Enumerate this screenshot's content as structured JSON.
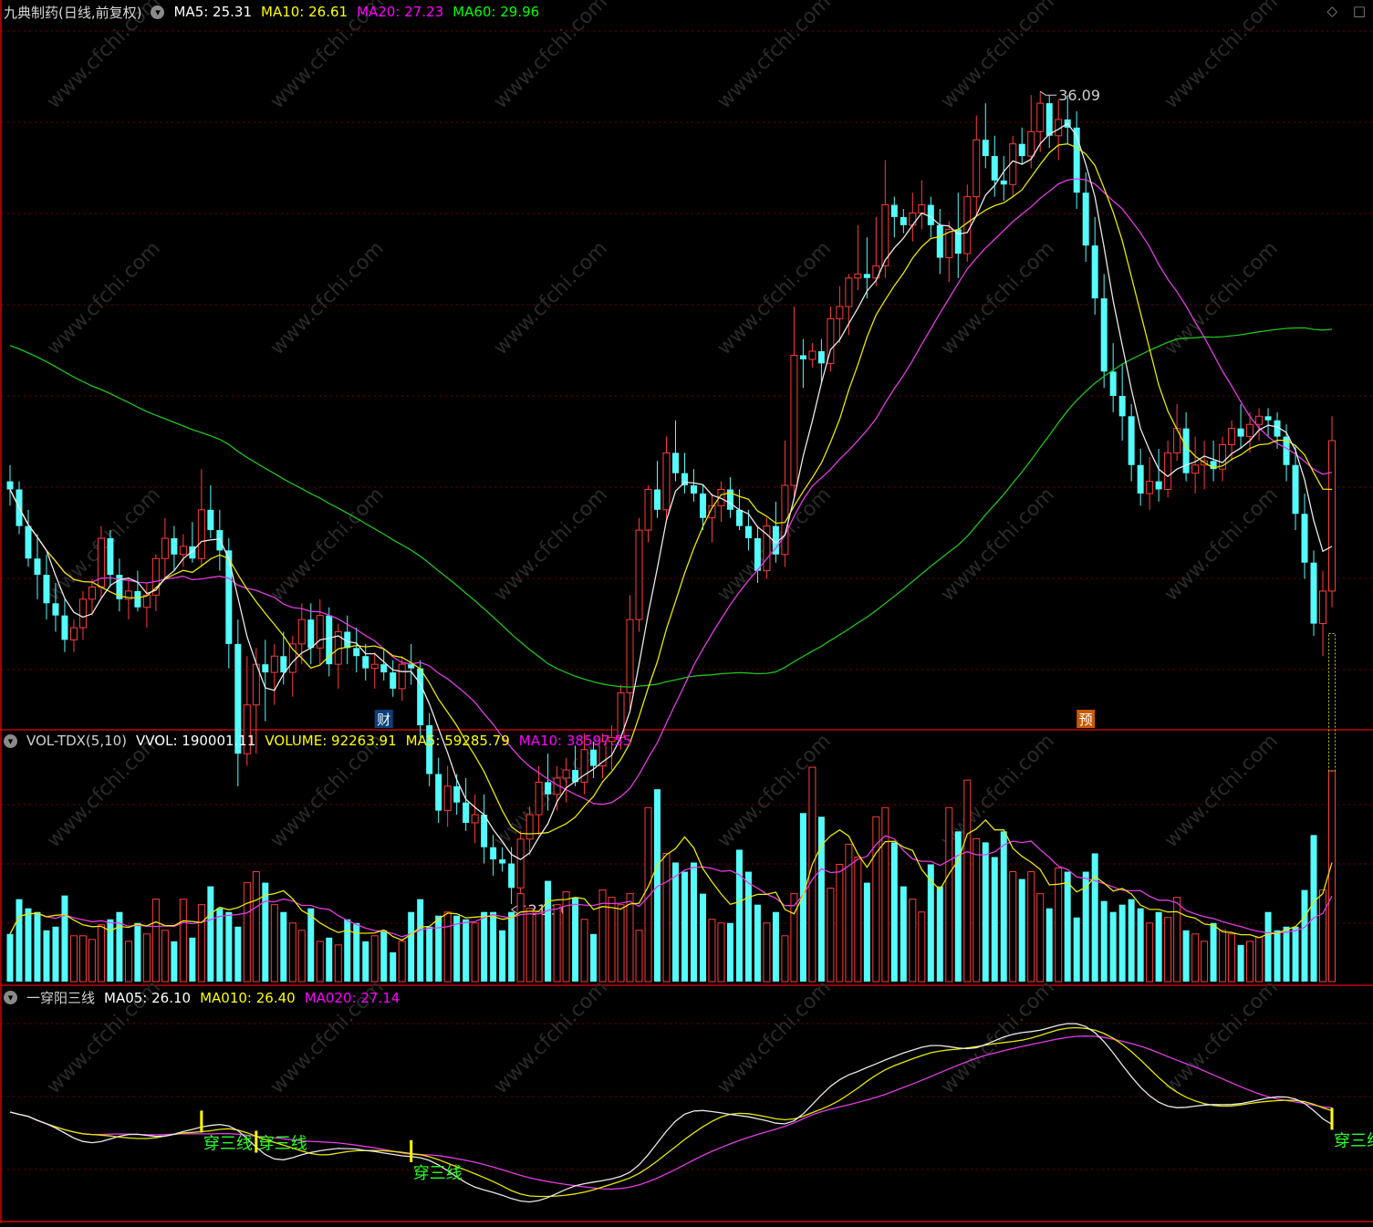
{
  "main": {
    "title": "九典制药(日线,前复权)",
    "ma_labels": [
      {
        "text": "MA5: 25.31",
        "color": "#ffffff"
      },
      {
        "text": "MA10: 26.61",
        "color": "#ffff00"
      },
      {
        "text": "MA20: 27.23",
        "color": "#ff00ff"
      },
      {
        "text": "MA60: 29.96",
        "color": "#00ff00"
      }
    ],
    "high_label": "36.09",
    "low_label": "21.30",
    "markers": [
      {
        "text": "财",
        "bg": "#0a3f7a",
        "color": "#ffffff"
      },
      {
        "text": "预",
        "bg": "#c85a00",
        "color": "#ffffff"
      }
    ],
    "icons": [
      "diamond-icon",
      "square-icon"
    ]
  },
  "volume_panel": {
    "labels": [
      {
        "text": "VOL-TDX(5,10)",
        "color": "#d0d0d0"
      },
      {
        "text": "VVOL: 190001.11",
        "color": "#ffffff"
      },
      {
        "text": "VOLUME: 92263.91",
        "color": "#ffff00"
      },
      {
        "text": "MA5: 59285.79",
        "color": "#ffff00"
      },
      {
        "text": "MA10: 38597.55",
        "color": "#ff00ff"
      }
    ]
  },
  "indicator_panel": {
    "labels": [
      {
        "text": "一穿阳三线",
        "color": "#d0d0d0"
      },
      {
        "text": "MA05: 26.10",
        "color": "#ffffff"
      },
      {
        "text": "MA010: 26.40",
        "color": "#ffff00"
      },
      {
        "text": "MA020: 27.14",
        "color": "#ff00ff"
      }
    ],
    "signal_label": "穿三线"
  },
  "watermark": "www.cfchi.com",
  "chart_data": {
    "type": "candlestick",
    "ylim": [
      20.5,
      37.8
    ],
    "bars": [
      [
        26.5,
        26.9,
        25.9,
        26.3,
        26
      ],
      [
        26.3,
        26.5,
        25.2,
        25.4,
        45
      ],
      [
        25.4,
        25.8,
        24.4,
        24.6,
        40
      ],
      [
        24.6,
        25.2,
        23.6,
        24.2,
        38
      ],
      [
        24.2,
        24.7,
        23.1,
        23.5,
        28
      ],
      [
        23.5,
        24.0,
        22.8,
        23.2,
        30
      ],
      [
        23.2,
        23.6,
        22.3,
        22.6,
        47
      ],
      [
        22.6,
        23.1,
        22.3,
        22.9,
        25
      ],
      [
        22.9,
        23.8,
        22.6,
        23.6,
        25
      ],
      [
        23.6,
        24.1,
        23.2,
        23.9,
        23
      ],
      [
        23.9,
        25.4,
        23.6,
        25.1,
        31
      ],
      [
        25.1,
        25.3,
        23.9,
        24.2,
        34
      ],
      [
        24.2,
        24.6,
        23.3,
        23.6,
        38
      ],
      [
        23.6,
        24.1,
        23.1,
        23.8,
        22
      ],
      [
        23.8,
        24.3,
        23.3,
        23.4,
        32
      ],
      [
        23.4,
        24.0,
        22.9,
        23.7,
        26
      ],
      [
        23.7,
        24.7,
        23.3,
        24.6,
        45
      ],
      [
        24.6,
        25.6,
        24.1,
        25.1,
        28
      ],
      [
        25.1,
        25.4,
        24.3,
        24.7,
        22
      ],
      [
        24.7,
        25.2,
        24.4,
        24.9,
        45
      ],
      [
        24.9,
        25.5,
        24.5,
        24.6,
        24
      ],
      [
        24.6,
        26.8,
        24.4,
        25.8,
        42
      ],
      [
        25.8,
        26.4,
        25.1,
        25.3,
        52
      ],
      [
        25.3,
        25.8,
        24.3,
        24.8,
        40
      ],
      [
        24.8,
        25.1,
        21.9,
        22.5,
        38
      ],
      [
        22.5,
        23.1,
        19.0,
        19.8,
        30
      ],
      [
        19.8,
        22.2,
        19.5,
        21.0,
        54
      ],
      [
        21.0,
        22.4,
        19.8,
        22.0,
        60
      ],
      [
        22.0,
        22.6,
        20.6,
        21.8,
        54
      ],
      [
        21.8,
        22.5,
        21.0,
        22.2,
        42
      ],
      [
        22.2,
        22.8,
        21.5,
        21.8,
        38
      ],
      [
        21.8,
        22.7,
        21.2,
        22.5,
        32
      ],
      [
        22.5,
        23.5,
        22.0,
        23.1,
        28
      ],
      [
        23.1,
        23.5,
        22.0,
        22.4,
        40
      ],
      [
        22.4,
        23.6,
        22.0,
        23.2,
        22
      ],
      [
        23.2,
        23.4,
        21.7,
        22.0,
        24
      ],
      [
        22.0,
        23.0,
        21.4,
        22.8,
        20
      ],
      [
        22.8,
        23.2,
        22.0,
        22.4,
        34
      ],
      [
        22.4,
        22.9,
        21.8,
        22.2,
        32
      ],
      [
        22.2,
        22.5,
        21.6,
        21.9,
        22
      ],
      [
        21.9,
        22.3,
        21.4,
        22.0,
        25
      ],
      [
        22.0,
        22.4,
        21.6,
        21.8,
        28
      ],
      [
        21.8,
        22.1,
        21.2,
        21.4,
        16
      ],
      [
        21.4,
        22.2,
        21.1,
        22.0,
        22
      ],
      [
        22.0,
        22.5,
        21.5,
        21.9,
        38
      ],
      [
        21.9,
        22.1,
        20.2,
        20.5,
        45
      ],
      [
        20.5,
        20.8,
        19.0,
        19.3,
        30
      ],
      [
        19.3,
        19.7,
        18.1,
        18.4,
        36
      ],
      [
        18.4,
        19.5,
        18.0,
        19.0,
        38
      ],
      [
        19.0,
        19.3,
        18.3,
        18.6,
        36
      ],
      [
        18.6,
        19.2,
        17.9,
        18.1,
        34
      ],
      [
        18.1,
        18.8,
        17.6,
        18.3,
        32
      ],
      [
        18.3,
        18.8,
        17.1,
        17.5,
        38
      ],
      [
        17.5,
        17.8,
        16.8,
        17.2,
        38
      ],
      [
        17.2,
        17.5,
        16.9,
        17.1,
        28
      ],
      [
        17.1,
        17.5,
        16.1,
        16.5,
        38
      ],
      [
        16.5,
        17.9,
        16.1,
        17.7,
        48
      ],
      [
        17.7,
        18.5,
        17.3,
        18.3,
        40
      ],
      [
        18.3,
        19.5,
        17.8,
        19.1,
        38
      ],
      [
        19.1,
        19.8,
        18.4,
        18.8,
        55
      ],
      [
        18.8,
        19.5,
        18.4,
        19.2,
        42
      ],
      [
        19.2,
        19.7,
        18.6,
        19.4,
        49
      ],
      [
        19.4,
        20.0,
        19.0,
        19.1,
        46
      ],
      [
        19.1,
        20.3,
        18.8,
        19.9,
        34
      ],
      [
        19.9,
        20.1,
        19.2,
        19.5,
        26
      ],
      [
        19.5,
        20.3,
        19.2,
        20.1,
        50
      ],
      [
        20.1,
        20.5,
        19.4,
        20.2,
        46
      ],
      [
        20.2,
        21.5,
        19.9,
        21.3,
        42
      ],
      [
        21.3,
        23.7,
        20.9,
        23.1,
        48
      ],
      [
        23.1,
        25.6,
        22.8,
        25.3,
        28
      ],
      [
        25.3,
        26.4,
        25.0,
        26.3,
        95
      ],
      [
        26.3,
        27.0,
        25.6,
        25.8,
        105
      ],
      [
        25.8,
        27.6,
        25.5,
        27.2,
        70
      ],
      [
        27.2,
        28.0,
        26.5,
        26.7,
        65
      ],
      [
        26.7,
        27.2,
        26.2,
        26.4,
        60
      ],
      [
        26.4,
        26.8,
        26.0,
        26.2,
        65
      ],
      [
        26.2,
        26.4,
        25.3,
        25.6,
        48
      ],
      [
        25.6,
        26.2,
        25.0,
        25.9,
        34
      ],
      [
        25.9,
        26.5,
        25.5,
        26.3,
        32
      ],
      [
        26.3,
        26.6,
        25.6,
        25.8,
        32
      ],
      [
        25.8,
        26.3,
        25.3,
        25.4,
        72
      ],
      [
        25.4,
        25.8,
        24.8,
        25.1,
        60
      ],
      [
        25.1,
        25.4,
        24.0,
        24.3,
        42
      ],
      [
        24.3,
        25.6,
        24.1,
        25.4,
        32
      ],
      [
        25.4,
        26.0,
        24.5,
        24.7,
        38
      ],
      [
        24.7,
        27.5,
        24.4,
        26.4,
        25
      ],
      [
        26.4,
        30.8,
        26.1,
        29.6,
        48
      ],
      [
        29.6,
        30.0,
        28.8,
        29.5,
        92
      ],
      [
        29.5,
        29.9,
        29.3,
        29.7,
        117
      ],
      [
        29.7,
        30.0,
        28.9,
        29.4,
        90
      ],
      [
        29.4,
        30.8,
        29.2,
        30.5,
        51
      ],
      [
        30.5,
        31.3,
        29.9,
        30.8,
        64
      ],
      [
        30.8,
        31.6,
        30.1,
        31.5,
        75
      ],
      [
        31.5,
        32.8,
        31.2,
        31.6,
        68
      ],
      [
        31.6,
        32.5,
        31.0,
        31.5,
        54
      ],
      [
        31.5,
        33.0,
        31.3,
        31.8,
        90
      ],
      [
        31.8,
        34.4,
        31.5,
        33.3,
        95
      ],
      [
        33.3,
        33.5,
        32.5,
        33.0,
        76
      ],
      [
        33.0,
        33.2,
        32.6,
        32.8,
        52
      ],
      [
        32.8,
        33.6,
        32.4,
        33.1,
        45
      ],
      [
        33.1,
        33.9,
        32.7,
        33.3,
        38
      ],
      [
        33.3,
        33.5,
        32.5,
        32.8,
        64
      ],
      [
        32.8,
        33.2,
        31.6,
        32.0,
        52
      ],
      [
        32.0,
        32.9,
        31.4,
        32.7,
        95
      ],
      [
        32.7,
        33.6,
        31.5,
        32.1,
        82
      ],
      [
        32.1,
        33.8,
        31.9,
        33.5,
        110
      ],
      [
        33.5,
        35.5,
        33.0,
        34.9,
        78
      ],
      [
        34.9,
        35.8,
        34.2,
        34.5,
        76
      ],
      [
        34.5,
        35.0,
        33.5,
        33.9,
        68
      ],
      [
        33.9,
        34.5,
        33.4,
        33.8,
        82
      ],
      [
        33.8,
        35.0,
        33.5,
        34.8,
        60
      ],
      [
        34.8,
        35.2,
        34.3,
        34.5,
        56
      ],
      [
        34.5,
        36.0,
        34.2,
        35.1,
        60
      ],
      [
        35.1,
        36.09,
        34.6,
        35.8,
        48
      ],
      [
        35.8,
        36.0,
        34.7,
        35.0,
        40
      ],
      [
        35.0,
        35.9,
        34.4,
        35.4,
        62
      ],
      [
        35.4,
        36.0,
        34.8,
        35.2,
        60
      ],
      [
        35.2,
        35.6,
        33.2,
        33.6,
        35
      ],
      [
        33.6,
        34.1,
        31.9,
        32.3,
        60
      ],
      [
        32.3,
        33.0,
        30.6,
        31.0,
        70
      ],
      [
        31.0,
        31.6,
        28.8,
        29.2,
        44
      ],
      [
        29.2,
        29.9,
        28.2,
        28.6,
        38
      ],
      [
        28.6,
        29.4,
        27.5,
        28.1,
        42
      ],
      [
        28.1,
        28.4,
        26.5,
        26.9,
        45
      ],
      [
        26.9,
        27.3,
        25.9,
        26.2,
        40
      ],
      [
        26.2,
        27.1,
        25.8,
        26.5,
        32
      ],
      [
        26.5,
        27.3,
        26.0,
        26.3,
        38
      ],
      [
        26.3,
        27.5,
        26.1,
        27.2,
        35
      ],
      [
        27.2,
        28.4,
        27.0,
        27.8,
        46
      ],
      [
        27.8,
        28.2,
        26.5,
        26.7,
        28
      ],
      [
        26.7,
        27.6,
        26.2,
        26.9,
        26
      ],
      [
        26.9,
        27.5,
        26.3,
        27.0,
        22
      ],
      [
        27.0,
        27.5,
        26.5,
        26.8,
        32
      ],
      [
        26.8,
        27.6,
        26.5,
        27.4,
        28
      ],
      [
        27.4,
        28.0,
        27.0,
        27.8,
        26
      ],
      [
        27.8,
        28.4,
        27.3,
        27.6,
        20
      ],
      [
        27.6,
        28.2,
        27.2,
        27.9,
        22
      ],
      [
        27.9,
        28.3,
        27.5,
        28.1,
        24
      ],
      [
        28.1,
        28.3,
        27.6,
        28.0,
        38
      ],
      [
        28.0,
        28.2,
        27.3,
        27.6,
        28
      ],
      [
        27.6,
        27.9,
        26.5,
        26.9,
        30
      ],
      [
        26.9,
        27.4,
        25.3,
        25.7,
        30
      ],
      [
        25.7,
        26.2,
        24.1,
        24.5,
        50
      ],
      [
        24.5,
        24.8,
        22.7,
        23.0,
        80
      ],
      [
        23.0,
        24.3,
        22.2,
        23.8,
        50
      ],
      [
        23.8,
        28.1,
        23.4,
        27.5,
        115
      ]
    ]
  }
}
